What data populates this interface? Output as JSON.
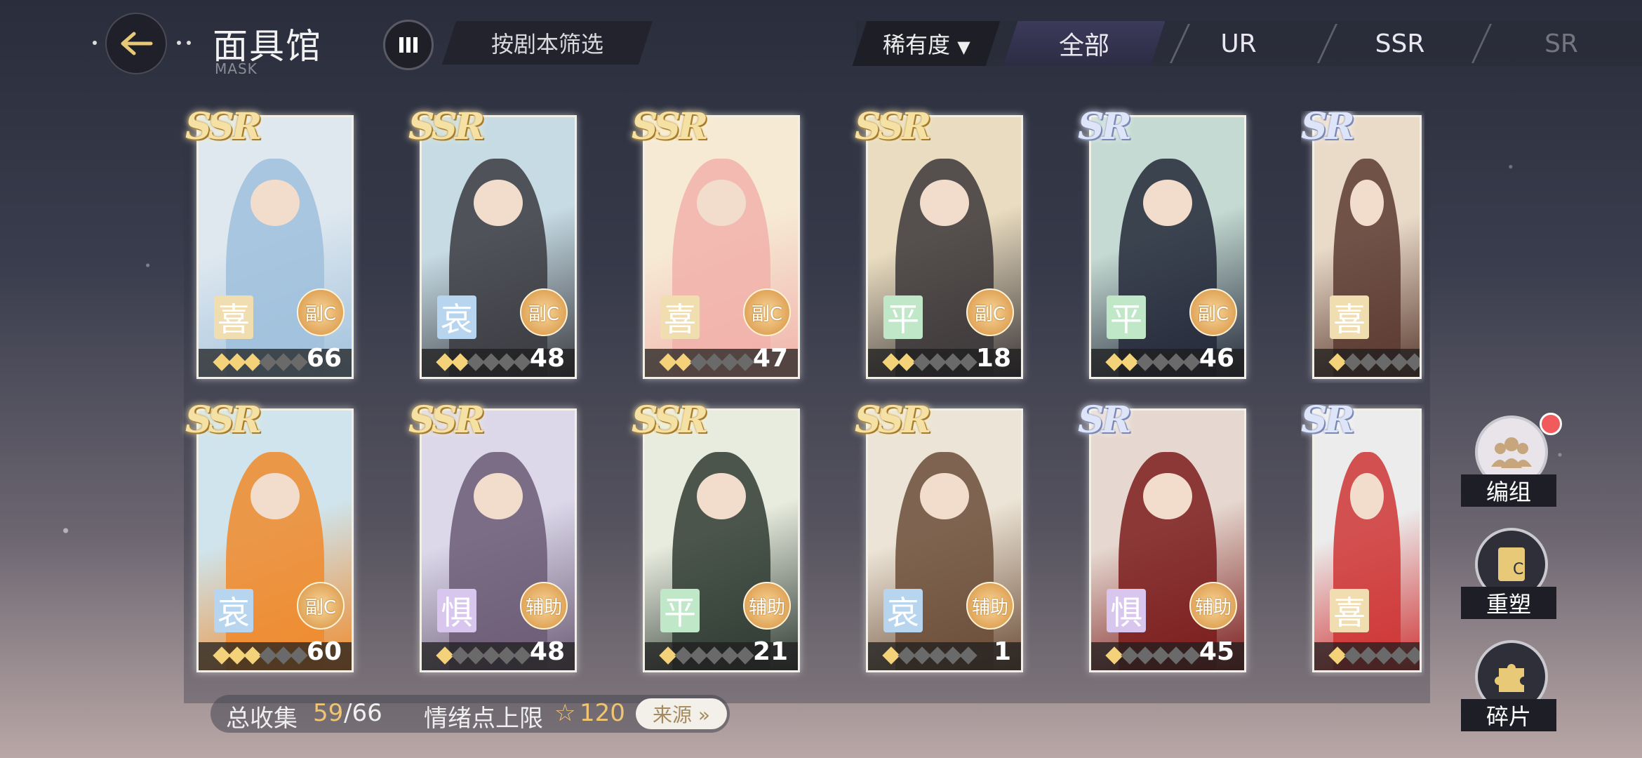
{
  "header": {
    "title": "面具馆",
    "subtitle": "MASK",
    "filter_script_label": "按剧本筛选",
    "rarity_sort_label": "稀有度",
    "tabs": [
      {
        "label": "全部",
        "active": true
      },
      {
        "label": "UR",
        "active": false
      },
      {
        "label": "SSR",
        "active": false
      },
      {
        "label": "SR",
        "active": false
      }
    ]
  },
  "cards": [
    {
      "rarity": "SSR",
      "emotion": "喜",
      "role": "副C",
      "stars": 3,
      "level": "66",
      "palette": [
        "#dfe8ef",
        "#9fc0dc"
      ]
    },
    {
      "rarity": "SSR",
      "emotion": "哀",
      "role": "副C",
      "stars": 2,
      "level": "48",
      "palette": [
        "#c6dbe4",
        "#3a3a40"
      ]
    },
    {
      "rarity": "SSR",
      "emotion": "喜",
      "role": "副C",
      "stars": 2,
      "level": "47",
      "palette": [
        "#f6ead5",
        "#f1b1aa"
      ]
    },
    {
      "rarity": "SSR",
      "emotion": "平",
      "role": "副C",
      "stars": 2,
      "level": "18",
      "palette": [
        "#e9dcc0",
        "#3b3638"
      ]
    },
    {
      "rarity": "SR",
      "emotion": "平",
      "role": "副C",
      "stars": 2,
      "level": "46",
      "palette": [
        "#c4dad2",
        "#232838"
      ]
    },
    {
      "rarity": "SR",
      "emotion": "喜",
      "role": "",
      "stars": 1,
      "level": "",
      "palette": [
        "#eadbc9",
        "#5a3a30"
      ]
    },
    {
      "rarity": "SSR",
      "emotion": "哀",
      "role": "副C",
      "stars": 3,
      "level": "60",
      "palette": [
        "#cfe4ec",
        "#f08a2c"
      ]
    },
    {
      "rarity": "SSR",
      "emotion": "惧",
      "role": "辅助",
      "stars": 1,
      "level": "48",
      "palette": [
        "#dcd8ea",
        "#6b5b74"
      ]
    },
    {
      "rarity": "SSR",
      "emotion": "平",
      "role": "辅助",
      "stars": 1,
      "level": "21",
      "palette": [
        "#e8ecdf",
        "#2f3b33"
      ]
    },
    {
      "rarity": "SSR",
      "emotion": "哀",
      "role": "辅助",
      "stars": 1,
      "level": "1",
      "palette": [
        "#ece4d6",
        "#6b4d38"
      ]
    },
    {
      "rarity": "SR",
      "emotion": "惧",
      "role": "辅助",
      "stars": 1,
      "level": "45",
      "palette": [
        "#e6d8d0",
        "#7a1c1c"
      ]
    },
    {
      "rarity": "SR",
      "emotion": "喜",
      "role": "",
      "stars": 1,
      "level": "",
      "palette": [
        "#ececec",
        "#cf3535"
      ]
    }
  ],
  "footer": {
    "collect_label": "总收集",
    "collect_owned": "59",
    "collect_total": "/66",
    "emotion_label": "情绪点上限",
    "emotion_value": "120",
    "source_label": "来源 »"
  },
  "side_buttons": [
    {
      "label": "编组",
      "icon": "team-icon",
      "badge": true
    },
    {
      "label": "重塑",
      "icon": "reshape-card-icon",
      "badge": false
    },
    {
      "label": "碎片",
      "icon": "puzzle-piece-icon",
      "badge": false
    }
  ],
  "colors": {
    "emotion_joy": "#f1deb0",
    "emotion_sad": "#b7d5ef",
    "emotion_calm": "#bfe7c8",
    "emotion_fear": "#d8c6ee",
    "gold": "#f0c470"
  }
}
